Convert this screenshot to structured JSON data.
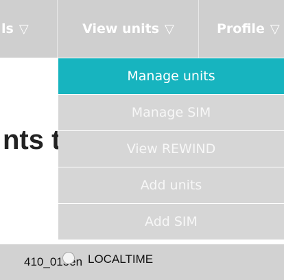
{
  "nav": {
    "left_partial_label": "ls",
    "view_units_label": "View units",
    "profile_label": "Profile"
  },
  "heading_fragment": "nts t",
  "dropdown": {
    "items": [
      {
        "label": "Manage units",
        "active": true
      },
      {
        "label": "Manage SIM",
        "active": false
      },
      {
        "label": "View REWIND",
        "active": false
      },
      {
        "label": "Add units",
        "active": false
      },
      {
        "label": "Add SIM",
        "active": false
      }
    ]
  },
  "bottom": {
    "unit_id": "410_015en",
    "timezone_label": "LOCALTIME"
  },
  "colors": {
    "nav_bg": "#cfcfcf",
    "active_bg": "#17b4bf",
    "item_bg": "#d6d6d6"
  }
}
